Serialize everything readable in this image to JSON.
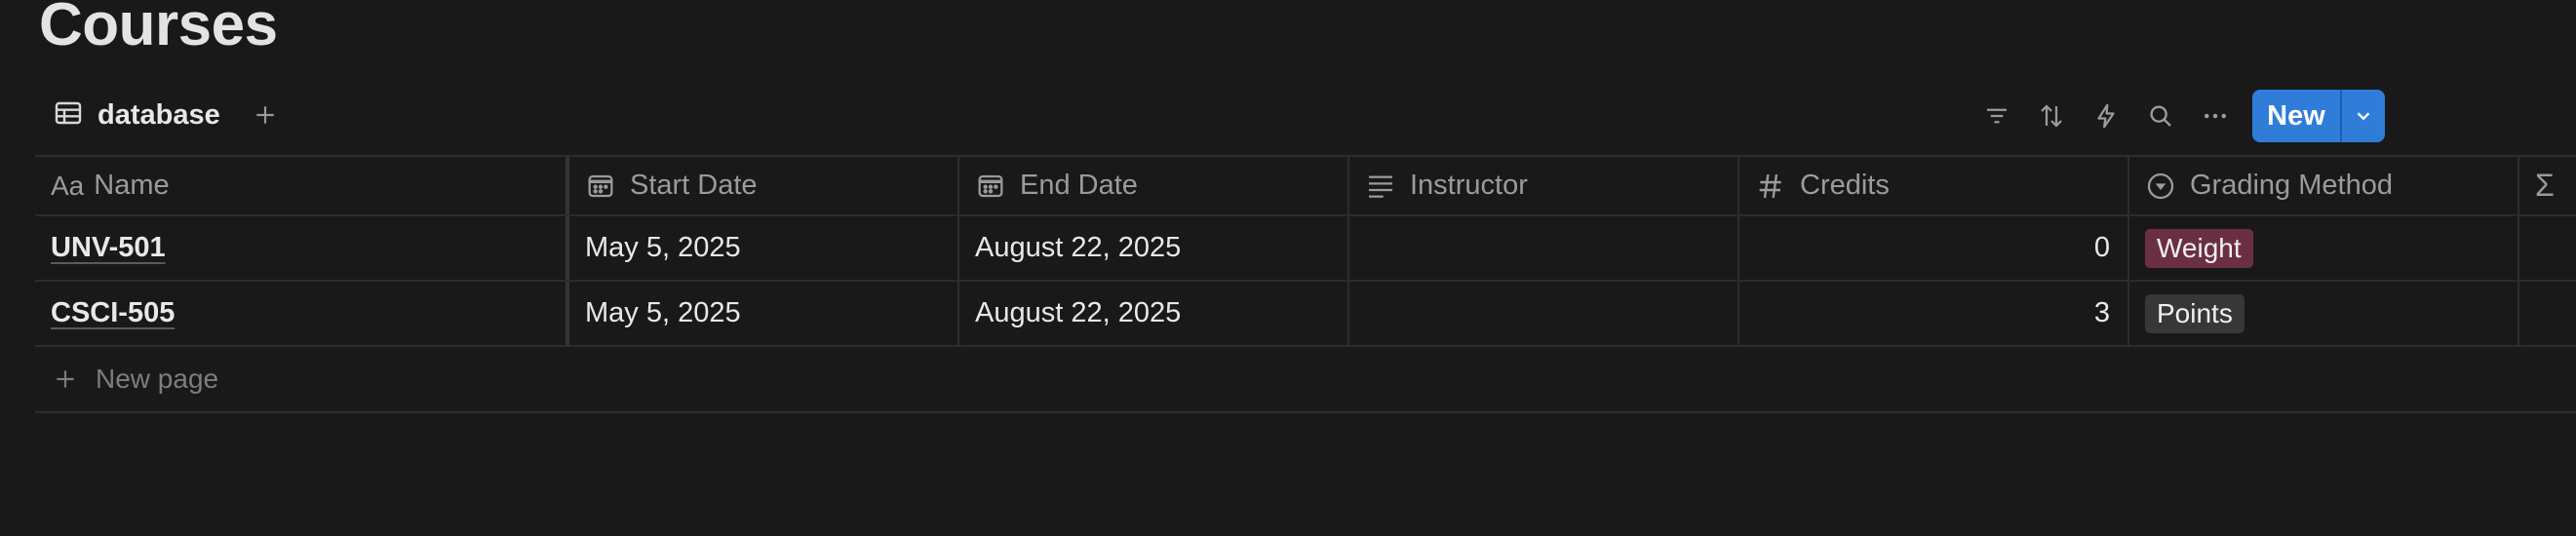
{
  "page": {
    "title": "Courses"
  },
  "view": {
    "tab_label": "database",
    "toolbar": {
      "filter": "filter-icon",
      "sort": "sort-icon",
      "automation": "lightning-icon",
      "search": "search-icon",
      "more": "ellipsis-icon",
      "new_label": "New"
    }
  },
  "table": {
    "columns": [
      {
        "label": "Name",
        "icon": "Aa"
      },
      {
        "label": "Start Date",
        "icon": "calendar-icon"
      },
      {
        "label": "End Date",
        "icon": "calendar-icon"
      },
      {
        "label": "Instructor",
        "icon": "text-lines-icon"
      },
      {
        "label": "Credits",
        "icon": "hash-icon"
      },
      {
        "label": "Grading Method",
        "icon": "select-icon"
      },
      {
        "label": "Σ",
        "icon": "sigma-icon"
      }
    ],
    "rows": [
      {
        "name": "UNV-501",
        "start_date": "May 5, 2025",
        "end_date": "August 22, 2025",
        "instructor": "",
        "credits": "0",
        "grading": {
          "label": "Weight",
          "color": "#6b2f45"
        }
      },
      {
        "name": "CSCI-505",
        "start_date": "May 5, 2025",
        "end_date": "August 22, 2025",
        "instructor": "",
        "credits": "3",
        "grading": {
          "label": "Points",
          "color": "#373737"
        }
      }
    ],
    "new_page_label": "New page"
  },
  "colors": {
    "background": "#191919",
    "accent": "#2f7dd9"
  }
}
